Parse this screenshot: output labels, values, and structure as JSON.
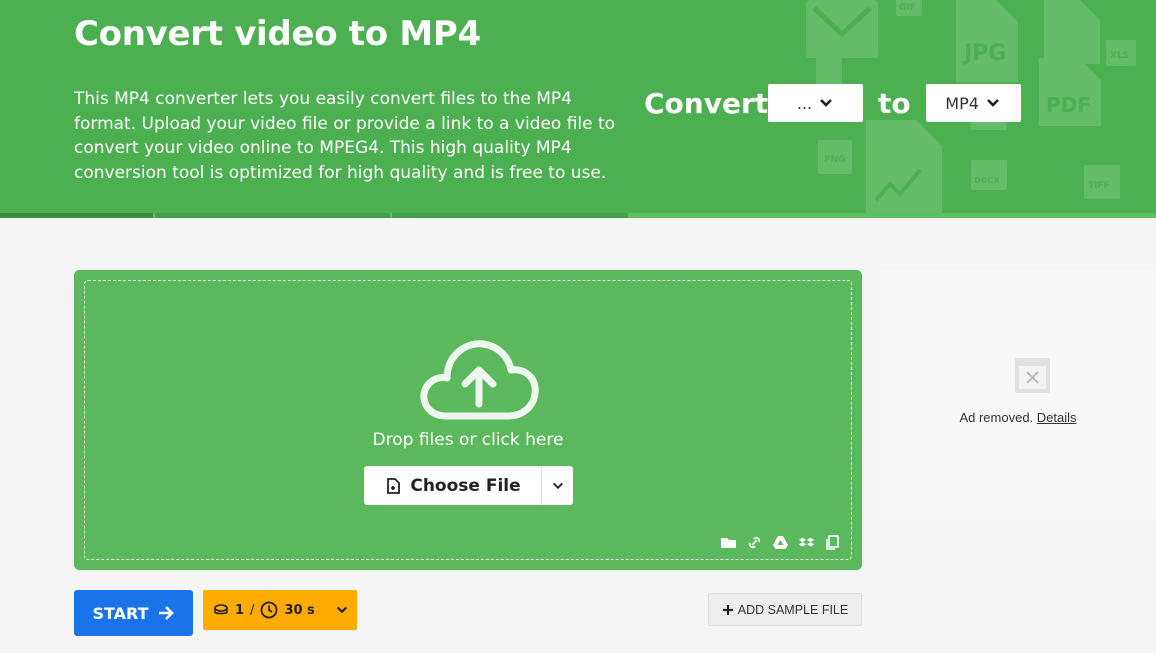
{
  "hero": {
    "title": "Convert video to MP4",
    "description": "This MP4 converter lets you easily convert files to the MP4 format. Upload your video file or provide a link to a video file to convert your video online to MPEG4. This high quality MP4 conversion tool is optimized for high quality and is free to use.",
    "convert_label": "Convert",
    "to_label": "to",
    "from_value": "...",
    "to_value": "MP4",
    "deco_formats": [
      "GIF",
      "JPG",
      "XLS",
      "PDF",
      "PNG",
      "DOCX",
      "TIFF"
    ]
  },
  "upload": {
    "drop_text": "Drop files or click here",
    "choose_label": "Choose File",
    "source_icons": [
      "folder-icon",
      "link-icon",
      "google-drive-icon",
      "dropbox-icon",
      "clipboard-icon"
    ]
  },
  "ad": {
    "text": "Ad removed.",
    "link": "Details"
  },
  "actions": {
    "start_label": "START",
    "credits_count": "1",
    "credits_sep": "/",
    "time_label": "30 s",
    "add_sample_label": "ADD SAMPLE FILE"
  },
  "colors": {
    "hero_green": "#4caf50",
    "upload_green": "#5cb85c",
    "start_blue": "#1a73e8",
    "credits_amber": "#ffab00"
  }
}
